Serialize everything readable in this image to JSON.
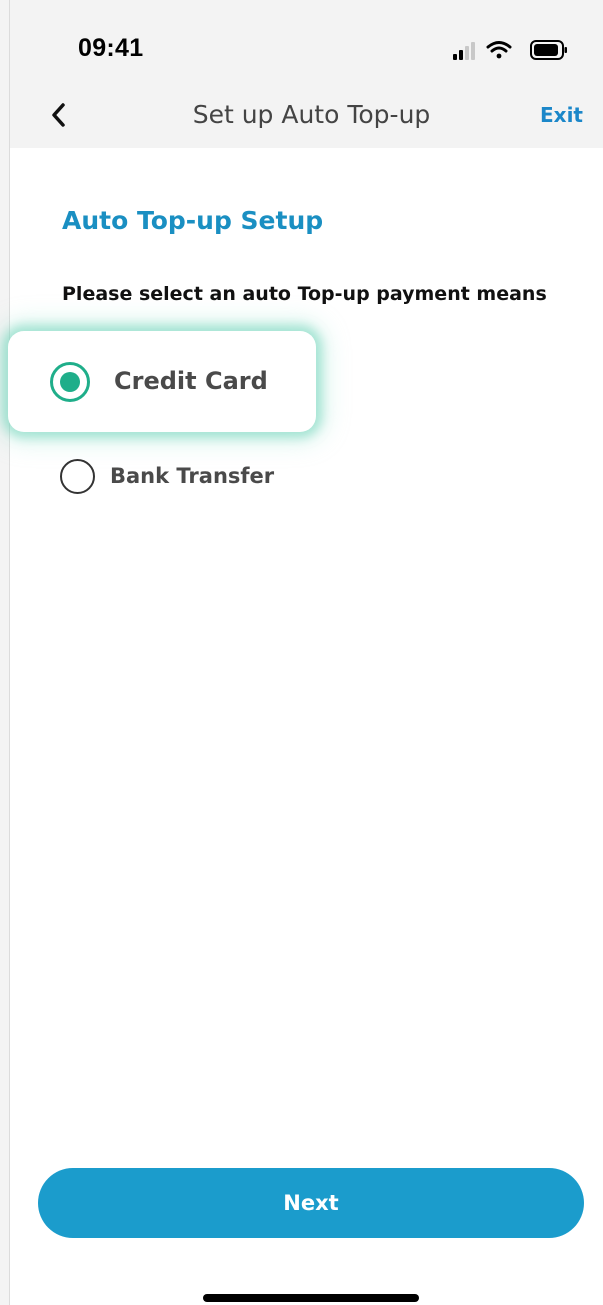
{
  "status_bar": {
    "time": "09:41",
    "icons": [
      "signal-icon",
      "wifi-icon",
      "battery-icon"
    ]
  },
  "nav": {
    "back_icon": "chevron-left-icon",
    "title": "Set up Auto Top-up",
    "exit_label": "Exit"
  },
  "content": {
    "section_title": "Auto Top-up Setup",
    "prompt": "Please select an auto Top-up payment means",
    "options": [
      {
        "label": "Credit Card",
        "selected": true
      },
      {
        "label": "Bank Transfer",
        "selected": false
      }
    ]
  },
  "footer": {
    "next_label": "Next"
  },
  "colors": {
    "accent_blue": "#1b9ccc",
    "title_blue": "#1a8fc2",
    "link_blue": "#1b87c9",
    "radio_green": "#1fae8a"
  }
}
